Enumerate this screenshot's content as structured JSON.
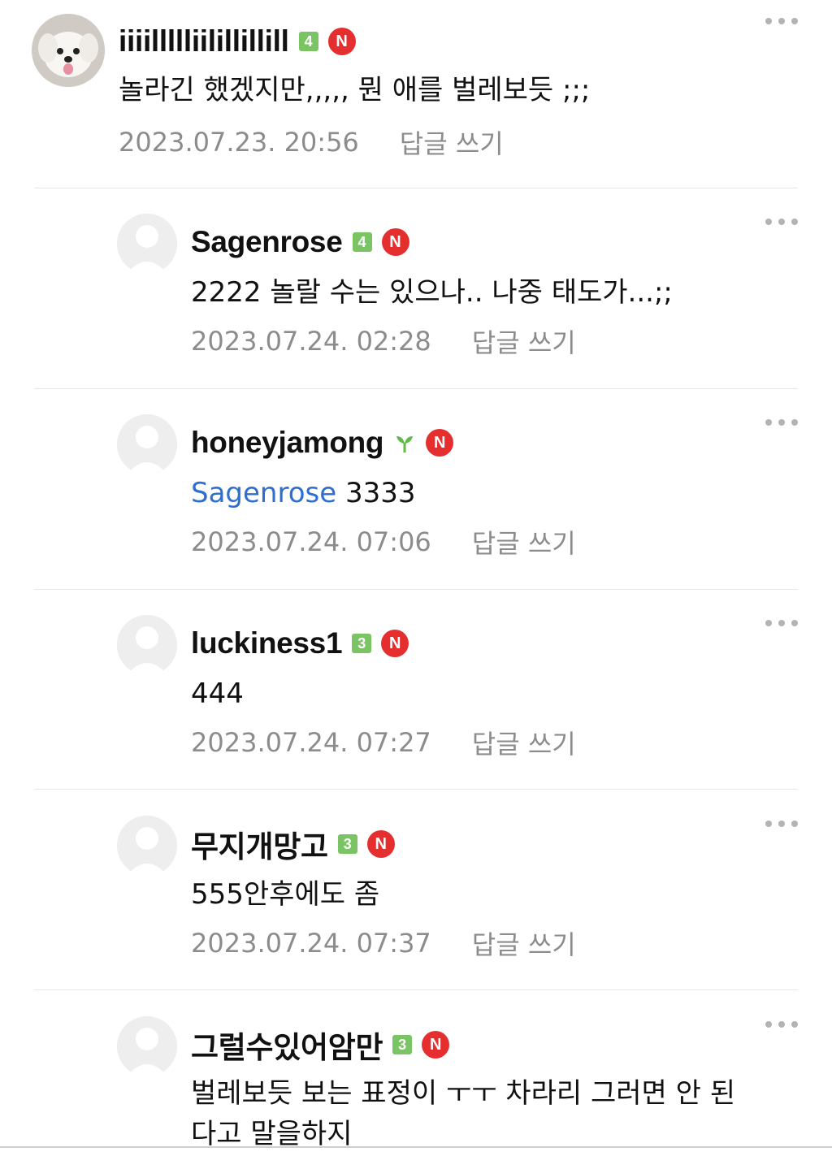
{
  "comments": [
    {
      "author": "iiiillllliilillillill",
      "grade": "4",
      "n_badge": "N",
      "text": "놀라긴 했겠지만,,,,, 뭔 애를 벌레보듯 ;;;",
      "time": "2023.07.23. 20:56",
      "reply_label": "답글 쓰기"
    },
    {
      "author": "Sagenrose",
      "grade": "4",
      "n_badge": "N",
      "text": "2222 놀랄 수는 있으나.. 나중 태도가...;;",
      "time": "2023.07.24. 02:28",
      "reply_label": "답글 쓰기"
    },
    {
      "author": "honeyjamong",
      "n_badge": "N",
      "mention": "Sagenrose",
      "text": " 3333",
      "time": "2023.07.24. 07:06",
      "reply_label": "답글 쓰기"
    },
    {
      "author": "luckiness1",
      "grade": "3",
      "n_badge": "N",
      "text": "444",
      "time": "2023.07.24. 07:27",
      "reply_label": "답글 쓰기"
    },
    {
      "author": "무지개망고",
      "grade": "3",
      "n_badge": "N",
      "text": "555안후에도 좀",
      "time": "2023.07.24. 07:37",
      "reply_label": "답글 쓰기"
    },
    {
      "author": "그럴수있어암만",
      "grade": "3",
      "n_badge": "N",
      "text": "벌레보듯 보는 표정이 ㅜㅜ 차라리 그러면 안 된다고 말을하지"
    }
  ],
  "colors": {
    "mention": "#2e6ed1",
    "grade_badge": "#7ac464",
    "n_badge": "#e52e2e",
    "meta": "#8c8c8c"
  }
}
